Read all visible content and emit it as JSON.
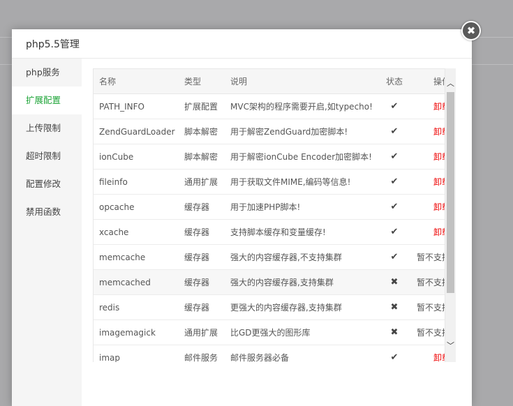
{
  "modal": {
    "title": "php5.5管理",
    "close_icon": "✖"
  },
  "sidebar": {
    "items": [
      {
        "label": "php服务",
        "active": false
      },
      {
        "label": "扩展配置",
        "active": true
      },
      {
        "label": "上传限制",
        "active": false
      },
      {
        "label": "超时限制",
        "active": false
      },
      {
        "label": "配置修改",
        "active": false
      },
      {
        "label": "禁用函数",
        "active": false
      }
    ]
  },
  "table": {
    "headers": {
      "name": "名称",
      "type": "类型",
      "desc": "说明",
      "status": "状态",
      "op": "操作"
    },
    "rows": [
      {
        "name": "PATH_INFO",
        "type": "扩展配置",
        "desc": "MVC架构的程序需要开启,如typecho!",
        "status": "✔",
        "op": "卸载"
      },
      {
        "name": "ZendGuardLoader",
        "type": "脚本解密",
        "desc": "用于解密ZendGuard加密脚本!",
        "status": "✔",
        "op": "卸载"
      },
      {
        "name": "ionCube",
        "type": "脚本解密",
        "desc": "用于解密ionCube Encoder加密脚本!",
        "status": "✔",
        "op": "卸载"
      },
      {
        "name": "fileinfo",
        "type": "通用扩展",
        "desc": "用于获取文件MIME,编码等信息!",
        "status": "✔",
        "op": "卸载"
      },
      {
        "name": "opcache",
        "type": "缓存器",
        "desc": "用于加速PHP脚本!",
        "status": "✔",
        "op": "卸载"
      },
      {
        "name": "xcache",
        "type": "缓存器",
        "desc": "支持脚本缓存和变量缓存!",
        "status": "✔",
        "op": "卸载"
      },
      {
        "name": "memcache",
        "type": "缓存器",
        "desc": "强大的内容缓存器,不支持集群",
        "status": "✔",
        "op": "暂不支持"
      },
      {
        "name": "memcached",
        "type": "缓存器",
        "desc": "强大的内容缓存器,支持集群",
        "status": "✖",
        "op": "暂不支持"
      },
      {
        "name": "redis",
        "type": "缓存器",
        "desc": "更强大的内容缓存器,支持集群",
        "status": "✖",
        "op": "暂不支持"
      },
      {
        "name": "imagemagick",
        "type": "通用扩展",
        "desc": "比GD更强大的图形库",
        "status": "✖",
        "op": "暂不支持"
      },
      {
        "name": "imap",
        "type": "邮件服务",
        "desc": "邮件服务器必备",
        "status": "✔",
        "op": "卸载"
      },
      {
        "name": "",
        "type": "",
        "desc": "",
        "status": "",
        "op": ""
      }
    ]
  },
  "scrollbar": {
    "up_icon": "︿",
    "down_icon": "﹀"
  },
  "colors": {
    "accent": "#20a53a",
    "danger": "#e00000",
    "backdrop": "#a9a9ab"
  }
}
